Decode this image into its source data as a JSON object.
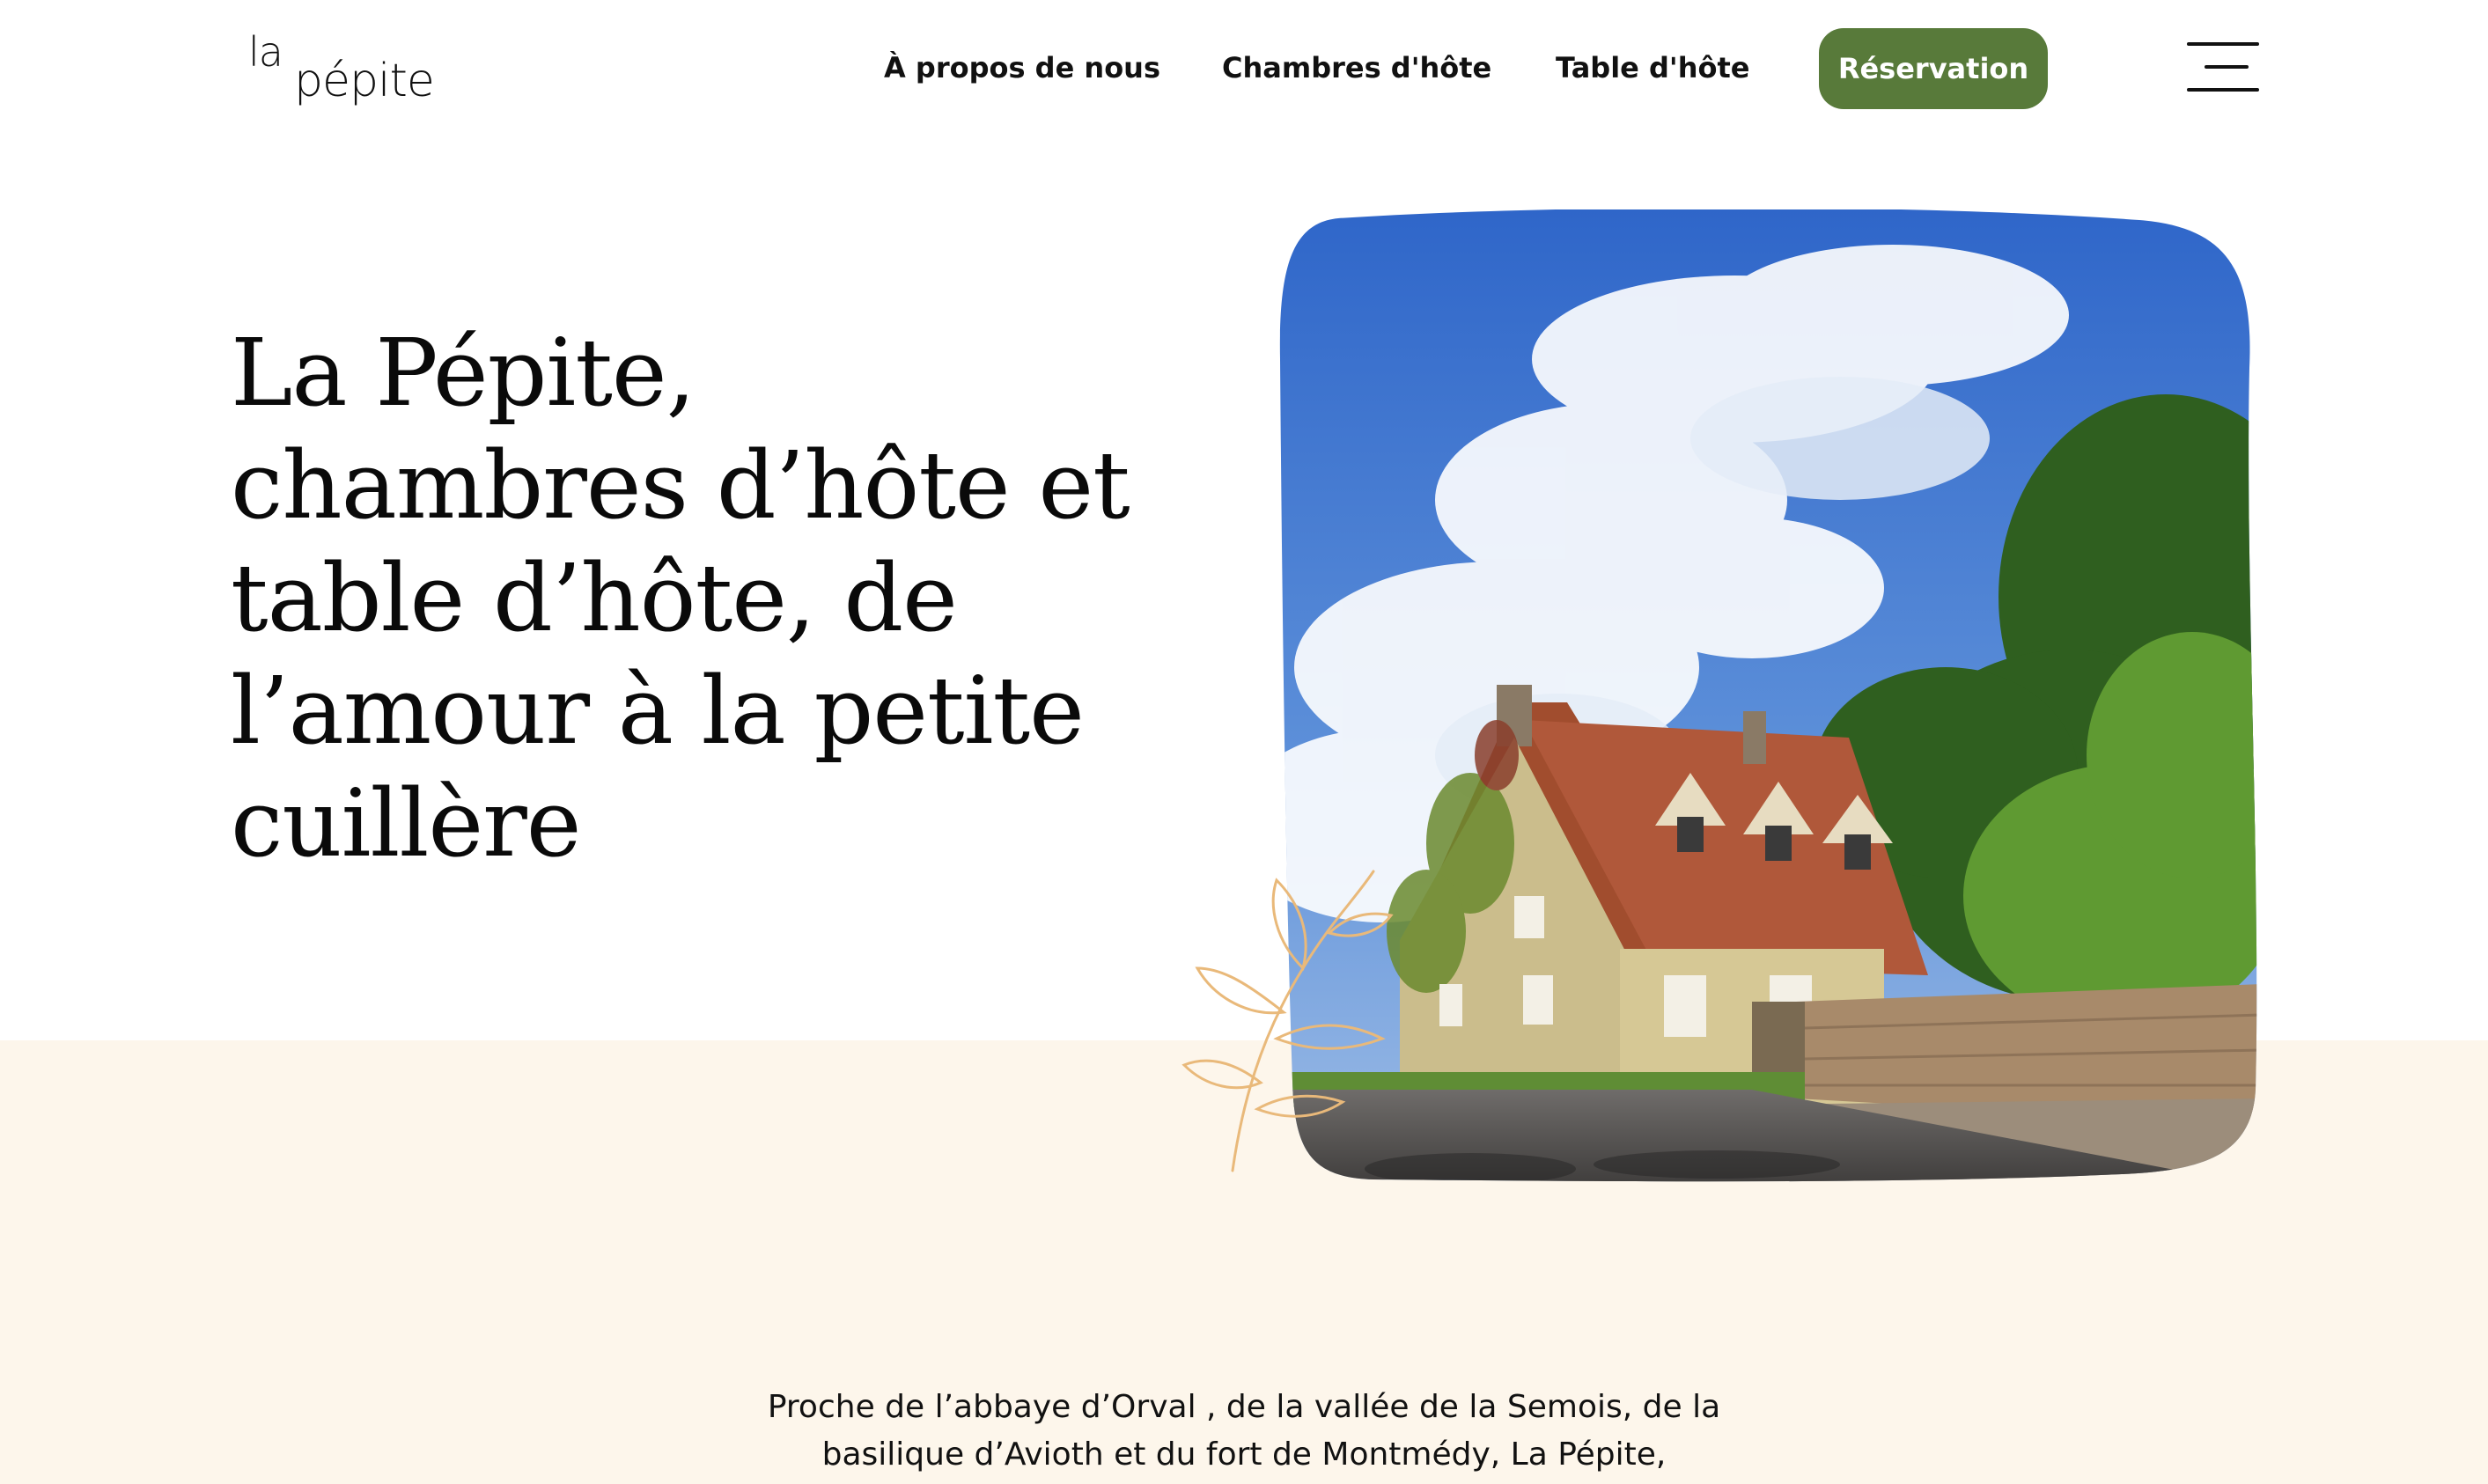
{
  "header": {
    "logo_line1": "la",
    "logo_line2": "pépite",
    "nav": [
      {
        "label": "À propos de nous"
      },
      {
        "label": "Chambres d'hôte"
      },
      {
        "label": "Table d'hôte"
      }
    ],
    "reservation_label": "Réservation",
    "menu_icon": "hamburger-menu-icon"
  },
  "hero": {
    "title": "La Pépite, chambres d’hôte et table d’hôte, de l’amour à la petite cuillère",
    "photo_alt": "",
    "decoration_icon": "leaf-branch-icon"
  },
  "intro": {
    "text": "Proche de l’abbaye d’Orval , de la vallée de la Semois, de la basilique d’Avioth et du fort de Montmédy, La Pépite,"
  },
  "colors": {
    "accent_green": "#587a3a",
    "cream_background": "#fdf6eb",
    "leaf_outline": "#e9b97a",
    "text": "#111111"
  }
}
